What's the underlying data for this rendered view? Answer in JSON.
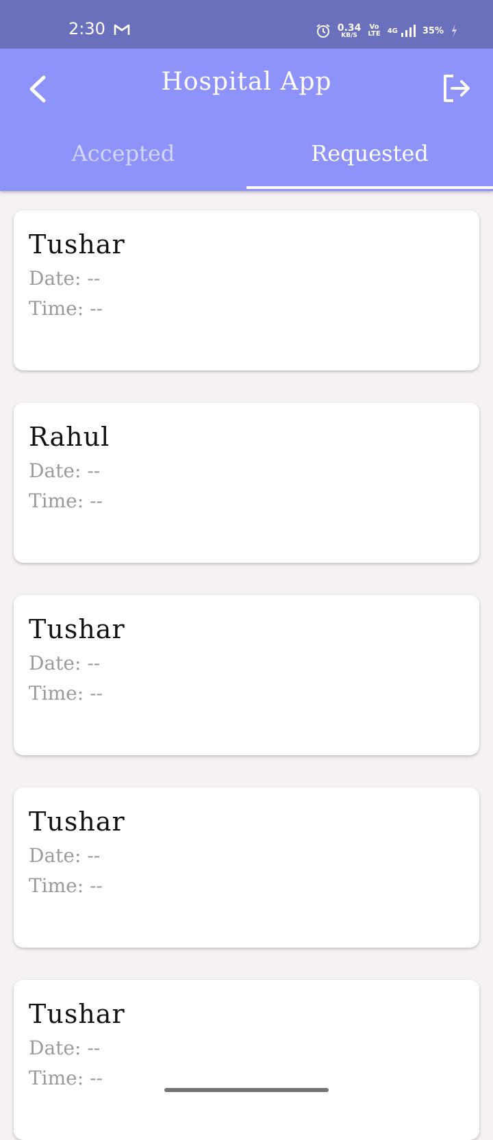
{
  "status_bar": {
    "time": "2:30",
    "net_speed_value": "0.34",
    "net_speed_unit": "KB/S",
    "volte_top": "Vo",
    "volte_bottom": "LTE",
    "network_type": "4G",
    "battery": "35%",
    "icons": [
      "gmail-icon",
      "alarm-icon",
      "signal-icon",
      "charging-icon"
    ]
  },
  "app_bar": {
    "title": "Hospital App",
    "back_icon": "chevron-left-icon",
    "logout_icon": "logout-icon"
  },
  "tabs": [
    {
      "label": "Accepted",
      "selected": false
    },
    {
      "label": "Requested",
      "selected": true
    }
  ],
  "colors": {
    "status_bar": "#6a70bb",
    "app_bar": "#8d93f9",
    "background": "#f5f1f4",
    "card": "#ffffff",
    "secondary_text": "#9a9a9a"
  },
  "labels": {
    "date": "Date:",
    "time": "Time:"
  },
  "requests": [
    {
      "name": "Tushar",
      "date": "--",
      "time": "--"
    },
    {
      "name": "Rahul",
      "date": "--",
      "time": "--"
    },
    {
      "name": "Tushar",
      "date": "--",
      "time": "--"
    },
    {
      "name": "Tushar",
      "date": "--",
      "time": "--"
    },
    {
      "name": "Tushar",
      "date": "--",
      "time": "--"
    }
  ]
}
